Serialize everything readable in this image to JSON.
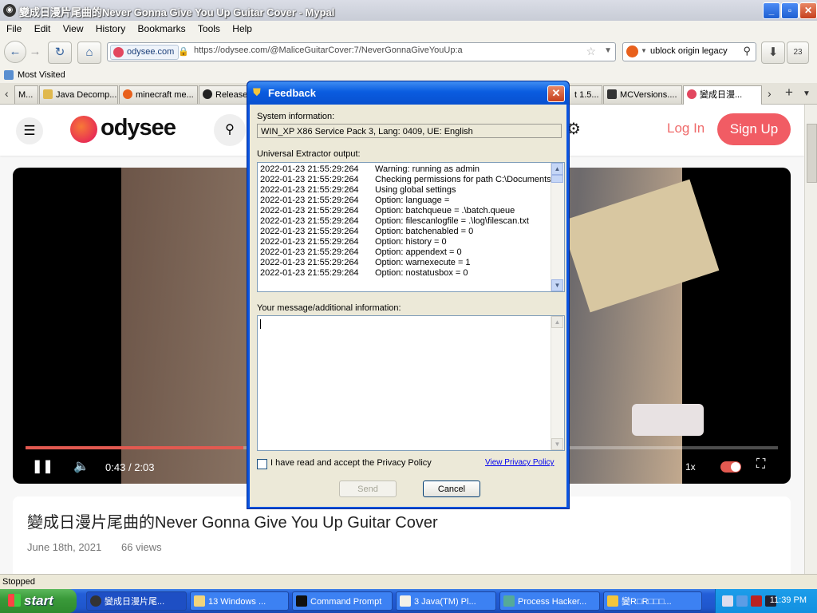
{
  "window": {
    "title": "變成日漫片尾曲的Never Gonna Give You Up Guitar Cover - Mypal",
    "minimize": "_",
    "maximize": "▫",
    "close": "✕"
  },
  "menu": [
    "File",
    "Edit",
    "View",
    "History",
    "Bookmarks",
    "Tools",
    "Help"
  ],
  "address": {
    "site_badge": "odysee.com",
    "url": "https://odysee.com/@MaliceGuitarCover:7/NeverGonnaGiveYouUp:a"
  },
  "search": {
    "value": "ublock origin legacy"
  },
  "downloads_badge": "23",
  "bookmarks": {
    "most_visited": "Most Visited"
  },
  "tabs": [
    {
      "label": "M..."
    },
    {
      "label": "Java Decomp..."
    },
    {
      "label": "minecraft me..."
    },
    {
      "label": "Release"
    },
    {
      "label": "t 1.5..."
    },
    {
      "label": "MCVersions...."
    },
    {
      "label": "變成日漫..."
    }
  ],
  "page": {
    "brand": "odysee",
    "login": "Log In",
    "signup": "Sign Up",
    "video": {
      "current_time": "0:43",
      "separator": "/",
      "duration": "2:03",
      "progress_fraction": 0.29,
      "speed": "1x"
    },
    "video_title": "變成日漫片尾曲的Never Gonna Give You Up Guitar Cover",
    "date": "June 18th, 2021",
    "views": "66 views"
  },
  "dialog": {
    "title": "Feedback",
    "system_label": "System information:",
    "system_value": "WIN_XP X86 Service Pack 3, Lang: 0409, UE: English",
    "output_label": "Universal Extractor output:",
    "log": [
      {
        "ts": "2022-01-23 21:55:29:264",
        "msg": "Warning: running as admin"
      },
      {
        "ts": "2022-01-23 21:55:29:264",
        "msg": "Checking permissions for path C:\\Documents a"
      },
      {
        "ts": "2022-01-23 21:55:29:264",
        "msg": "Using global settings"
      },
      {
        "ts": "2022-01-23 21:55:29:264",
        "msg": "Option: language ="
      },
      {
        "ts": "2022-01-23 21:55:29:264",
        "msg": "Option: batchqueue = .\\batch.queue"
      },
      {
        "ts": "2022-01-23 21:55:29:264",
        "msg": "Option: filescanlogfile = .\\log\\filescan.txt"
      },
      {
        "ts": "2022-01-23 21:55:29:264",
        "msg": "Option: batchenabled = 0"
      },
      {
        "ts": "2022-01-23 21:55:29:264",
        "msg": "Option: history = 0"
      },
      {
        "ts": "2022-01-23 21:55:29:264",
        "msg": "Option: appendext = 0"
      },
      {
        "ts": "2022-01-23 21:55:29:264",
        "msg": "Option: warnexecute = 1"
      },
      {
        "ts": "2022-01-23 21:55:29:264",
        "msg": "Option: nostatusbox = 0"
      }
    ],
    "message_label": "Your message/additional information:",
    "message_value": "",
    "privacy_label": "I have read and accept the Privacy Policy",
    "privacy_checked": false,
    "privacy_link": "View Privacy Policy",
    "send": "Send",
    "cancel": "Cancel"
  },
  "statusbar": "Stopped",
  "taskbar": {
    "start": "start",
    "tasks": [
      {
        "label": "變成日漫片尾..."
      },
      {
        "label": "13 Windows ..."
      },
      {
        "label": "Command Prompt"
      },
      {
        "label": "3 Java(TM) Pl..."
      },
      {
        "label": "Process Hacker..."
      },
      {
        "label": "變R□R□□□..."
      }
    ],
    "clock": "11:39 PM"
  }
}
